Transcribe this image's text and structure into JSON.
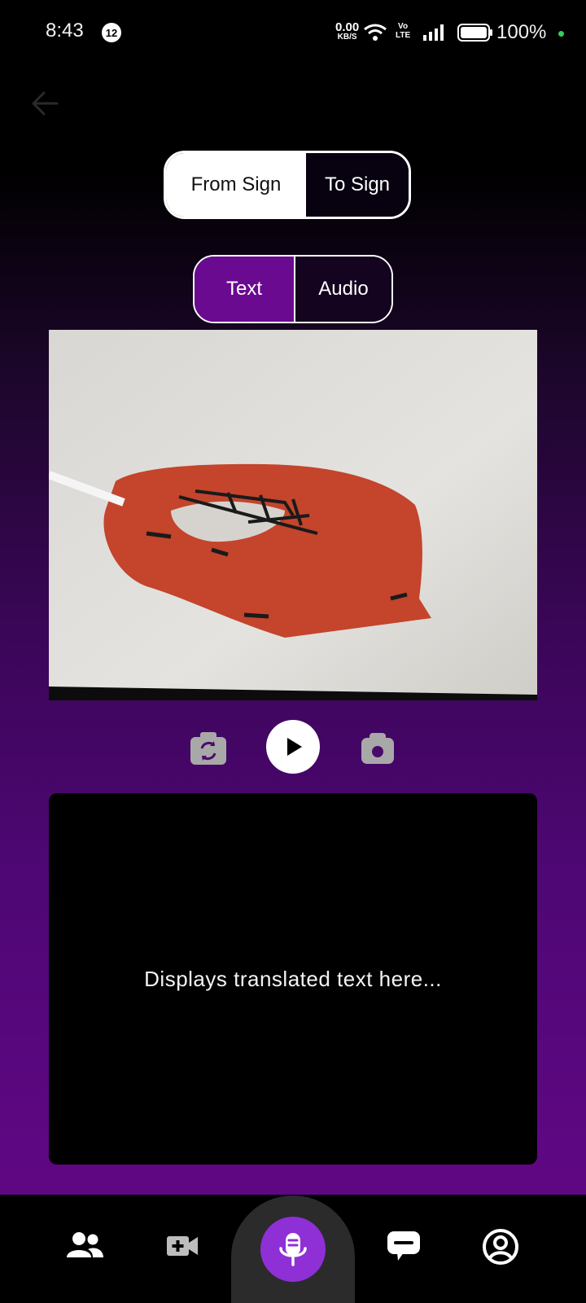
{
  "status_bar": {
    "time": "8:43",
    "notification_count": "12",
    "net_speed_value": "0.00",
    "net_speed_unit": "KB/S",
    "volte_top": "Vo",
    "volte_bottom": "LTE",
    "battery": "100%"
  },
  "mode_toggle": {
    "options": [
      "From Sign",
      "To Sign"
    ],
    "selected": "From Sign"
  },
  "output_toggle": {
    "options": [
      "Text",
      "Audio"
    ],
    "selected": "Text"
  },
  "controls": [
    "flip-camera-icon",
    "play-icon",
    "camera-icon"
  ],
  "output": {
    "placeholder": "Displays translated text here..."
  },
  "bottom_nav": {
    "items": [
      "people-icon",
      "video-call-icon",
      "microphone-icon",
      "chat-icon",
      "account-icon"
    ],
    "active": "microphone-icon"
  },
  "colors": {
    "accent_purple": "#6a0a91",
    "mic_button": "#8f2fd6",
    "online_dot": "#34d058"
  }
}
